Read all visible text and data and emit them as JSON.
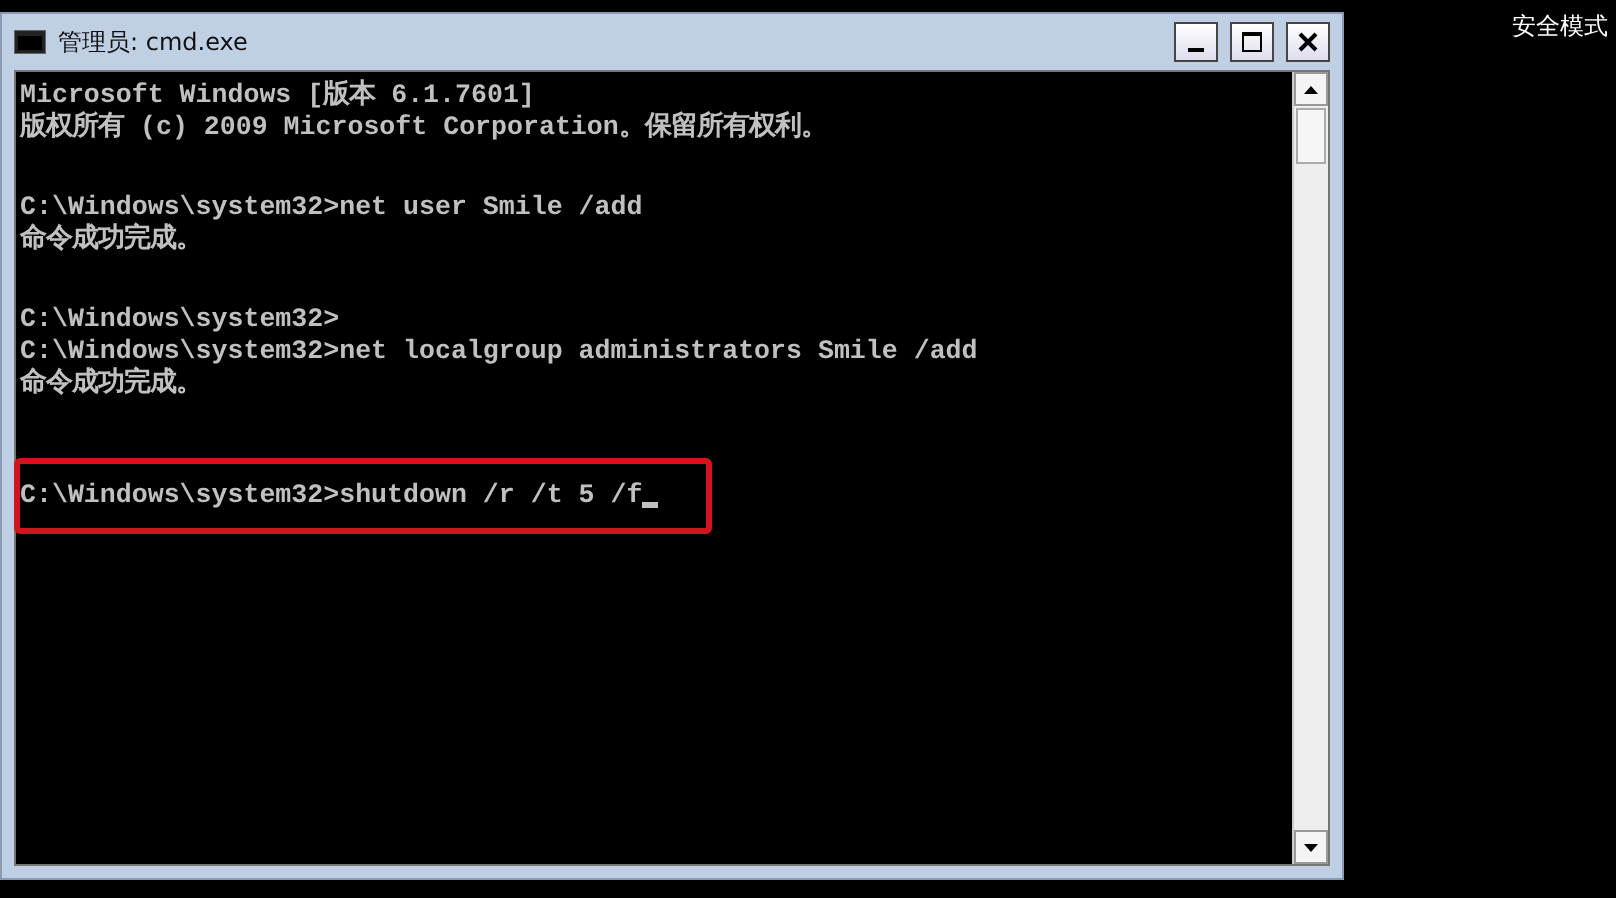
{
  "window": {
    "title": "管理员: cmd.exe"
  },
  "console": {
    "blocks": [
      {
        "highlighted": false,
        "lines": [
          {
            "text": "Microsoft Windows [版本 6.1.7601]",
            "cursor": false
          },
          {
            "text": "版权所有 (c) 2009 Microsoft Corporation。保留所有权利。",
            "cursor": false
          }
        ]
      },
      {
        "highlighted": false,
        "lines": [
          {
            "text": "C:\\Windows\\system32>net user Smile /add",
            "cursor": false
          },
          {
            "text": "命令成功完成。",
            "cursor": false
          }
        ]
      },
      {
        "highlighted": false,
        "lines": [
          {
            "text": "C:\\Windows\\system32>",
            "cursor": false
          },
          {
            "text": "C:\\Windows\\system32>net localgroup administrators Smile /add",
            "cursor": false
          },
          {
            "text": "命令成功完成。",
            "cursor": false
          }
        ]
      },
      {
        "highlighted": true,
        "lines": [
          {
            "text": "C:\\Windows\\system32>shutdown /r /t 5 /f",
            "cursor": true
          }
        ]
      }
    ]
  },
  "desktop": {
    "mode_label": "安全模式"
  }
}
